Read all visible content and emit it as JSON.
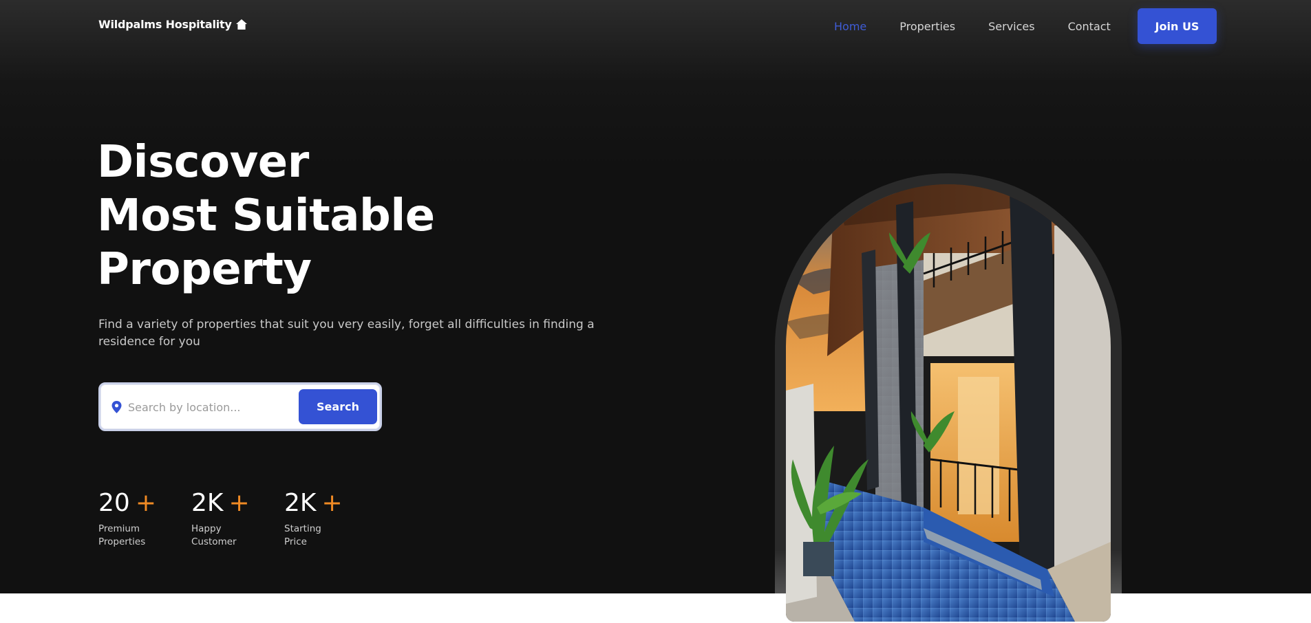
{
  "brand": {
    "name": "Wildpalms Hospitality",
    "icon": "home-icon"
  },
  "nav": {
    "items": [
      {
        "label": "Home",
        "active": true
      },
      {
        "label": "Properties",
        "active": false
      },
      {
        "label": "Services",
        "active": false
      },
      {
        "label": "Contact",
        "active": false
      }
    ],
    "cta_label": "Join US"
  },
  "hero": {
    "headline_lines": [
      "Discover",
      "Most Suitable",
      "Property"
    ],
    "subtitle": "Find a variety of properties that suit you very easily, forget all difficulties in finding a residence for you"
  },
  "search": {
    "placeholder": "Search by location...",
    "button_label": "Search",
    "icon": "location-pin-icon"
  },
  "stats": [
    {
      "value": "20",
      "suffix": "+",
      "label": "Premium Properties"
    },
    {
      "value": "2K",
      "suffix": "+",
      "label": "Happy Customer"
    },
    {
      "value": "2K",
      "suffix": "+",
      "label": "Starting Price"
    }
  ],
  "colors": {
    "accent": "#3452d4",
    "nav_active": "#3f5cd6",
    "plus": "#f08a24",
    "background": "#111111"
  }
}
